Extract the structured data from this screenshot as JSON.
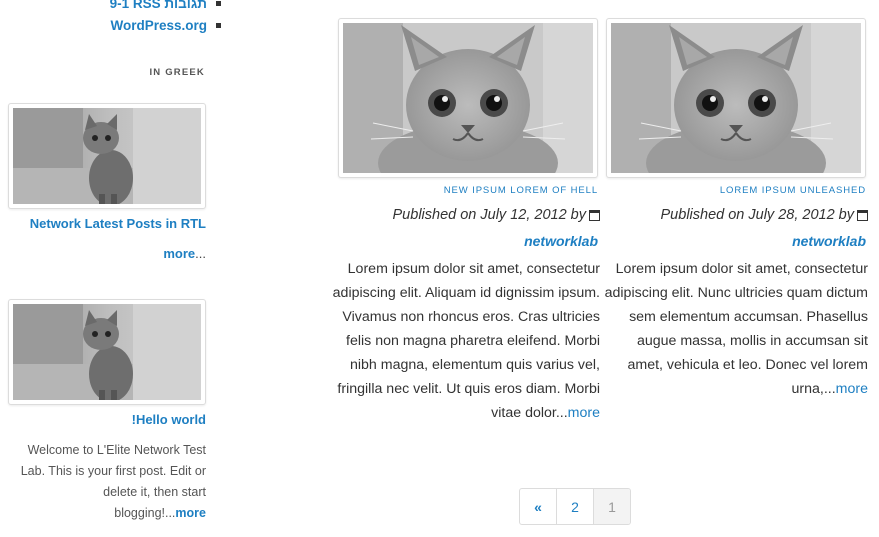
{
  "sidebar": {
    "top_links": [
      "9-1 RSS תגובות",
      "WordPress.org"
    ],
    "widget_title": "IN GREEK",
    "posts": [
      {
        "title": "Network Latest Posts in RTL",
        "more": "more",
        "more_suffix": "..."
      },
      {
        "title": "!Hello world",
        "excerpt": "Welcome to L'Elite Network Test Lab. This is your first post. Edit or delete it, then start blogging!...",
        "more": "more"
      }
    ]
  },
  "posts": [
    {
      "category": "NEW IPSUM LOREM OF HELL",
      "meta": "Published on July 12, 2012 by",
      "author": "networklab",
      "excerpt": "Lorem ipsum dolor sit amet, consectetur adipiscing elit. Aliquam id dignissim ipsum. Vivamus non rhoncus eros. Cras ultricies felis non magna pharetra eleifend. Morbi nibh magna, elementum quis varius vel, fringilla nec velit. Ut quis eros diam. Morbi vitae dolor...",
      "more": "more"
    },
    {
      "category": "LOREM IPSUM UNLEASHED",
      "meta": "Published on July 28, 2012 by",
      "author": "networklab",
      "excerpt": "Lorem ipsum dolor sit amet, consectetur adipiscing elit. Nunc ultricies quam dictum sem elementum accumsan. Phasellus augue massa, mollis in accumsan sit amet, vehicula et leo. Donec vel lorem urna,...",
      "more": "more"
    }
  ],
  "pagination": {
    "prev": "«",
    "pages": [
      "2",
      "1"
    ],
    "current": "1"
  },
  "icons": {
    "calendar": "calendar-icon",
    "bullet": "bullet-icon"
  },
  "colors": {
    "link": "#1e7fc2",
    "text": "#333333"
  }
}
